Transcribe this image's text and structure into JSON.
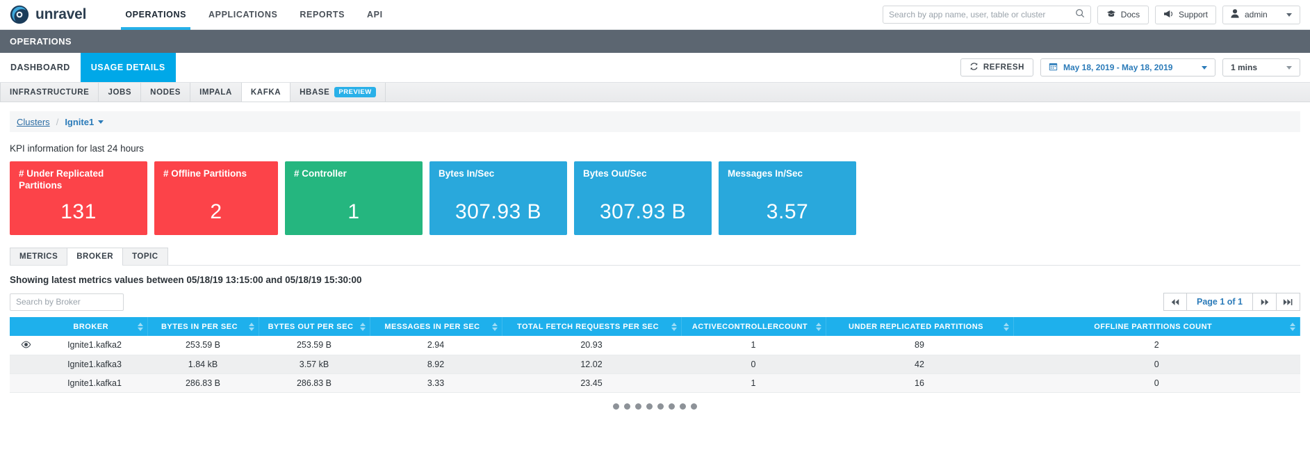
{
  "brand": {
    "name": "unravel",
    "logo_icon": "unravel-logo-icon"
  },
  "topnav": {
    "items": [
      {
        "label": "OPERATIONS",
        "active": true
      },
      {
        "label": "APPLICATIONS",
        "active": false
      },
      {
        "label": "REPORTS",
        "active": false
      },
      {
        "label": "API",
        "active": false
      }
    ],
    "search": {
      "placeholder": "Search by app name, user, table or cluster",
      "value": "",
      "icon": "search-icon"
    },
    "docs_label": "Docs",
    "docs_icon": "graduation-cap-icon",
    "support_label": "Support",
    "support_icon": "megaphone-icon",
    "user_label": "admin",
    "user_icon": "user-icon"
  },
  "opsbar": {
    "title": "OPERATIONS"
  },
  "subtabs": {
    "items": [
      {
        "label": "DASHBOARD",
        "active": false
      },
      {
        "label": "USAGE DETAILS",
        "active": true
      }
    ],
    "refresh_label": "REFRESH",
    "refresh_icon": "refresh-icon",
    "date_range": "May 18, 2019 - May 18, 2019",
    "calendar_icon": "calendar-icon",
    "interval": "1 mins"
  },
  "modtabs": [
    {
      "label": "INFRASTRUCTURE",
      "active": false,
      "badge": null
    },
    {
      "label": "JOBS",
      "active": false,
      "badge": null
    },
    {
      "label": "NODES",
      "active": false,
      "badge": null
    },
    {
      "label": "IMPALA",
      "active": false,
      "badge": null
    },
    {
      "label": "KAFKA",
      "active": true,
      "badge": null
    },
    {
      "label": "HBASE",
      "active": false,
      "badge": "PREVIEW"
    }
  ],
  "breadcrumb": {
    "root": "Clusters",
    "separator": "/",
    "current": "Ignite1"
  },
  "kpi": {
    "title": "KPI information for last 24 hours",
    "cards": [
      {
        "label": "# Under Replicated Partitions",
        "value": "131",
        "color": "#fc4349",
        "width": "w1"
      },
      {
        "label": "# Offline Partitions",
        "value": "2",
        "color": "#fc4349",
        "width": "w2"
      },
      {
        "label": "# Controller",
        "value": "1",
        "color": "#25b67f",
        "width": "w1"
      },
      {
        "label": "Bytes In/Sec",
        "value": "307.93 B",
        "color": "#29a8dc",
        "width": "w1"
      },
      {
        "label": "Bytes Out/Sec",
        "value": "307.93 B",
        "color": "#29a8dc",
        "width": "w1"
      },
      {
        "label": "Messages In/Sec",
        "value": "3.57",
        "color": "#29a8dc",
        "width": "w1"
      }
    ]
  },
  "metrics_panel": {
    "tabs": [
      {
        "label": "METRICS",
        "active": false
      },
      {
        "label": "BROKER",
        "active": true
      },
      {
        "label": "TOPIC",
        "active": false
      }
    ],
    "showing_line": "Showing latest metrics values between 05/18/19 13:15:00 and 05/18/19 15:30:00",
    "search_placeholder": "Search by Broker",
    "search_value": "",
    "pager": {
      "first_icon": "◀◀",
      "label": "Page 1 of 1",
      "next_icon": "▶▶",
      "last_icon": "▶▶|"
    },
    "columns": [
      "BROKER",
      "BYTES IN PER SEC",
      "BYTES OUT PER SEC",
      "MESSAGES IN PER SEC",
      "TOTAL FETCH REQUESTS PER SEC",
      "ACTIVECONTROLLERCOUNT",
      "UNDER REPLICATED PARTITIONS",
      "OFFLINE PARTITIONS COUNT"
    ],
    "rows": [
      {
        "eye": true,
        "cells": [
          "Ignite1.kafka2",
          "253.59 B",
          "253.59 B",
          "2.94",
          "20.93",
          "1",
          "89",
          "2"
        ]
      },
      {
        "eye": false,
        "cells": [
          "Ignite1.kafka3",
          "1.84 kB",
          "3.57 kB",
          "8.92",
          "12.02",
          "0",
          "42",
          "0"
        ]
      },
      {
        "eye": false,
        "cells": [
          "Ignite1.kafka1",
          "286.83 B",
          "286.83 B",
          "3.33",
          "23.45",
          "1",
          "16",
          "0"
        ]
      }
    ],
    "loading_dots": 8
  }
}
